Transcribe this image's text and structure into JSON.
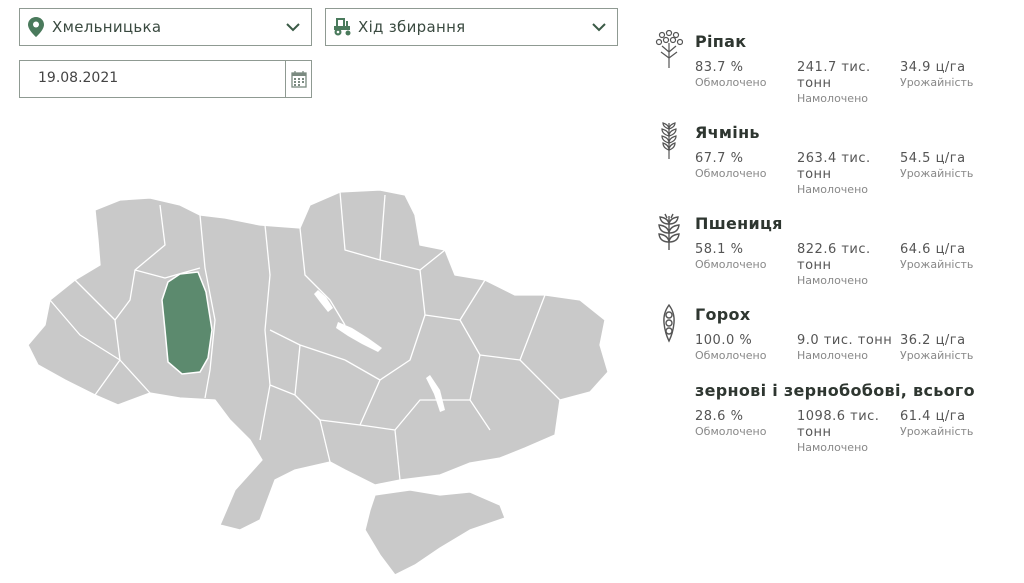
{
  "filters": {
    "region": {
      "value": "Хмельницька"
    },
    "mode": {
      "value": "Хід збирання"
    },
    "date": {
      "value": "19.08.2021"
    }
  },
  "map": {
    "selected_region": "Хмельницька",
    "selected_color": "#5c8a6e",
    "base_color": "#c9c9c9"
  },
  "crops": [
    {
      "name": "Ріпак",
      "icon": "rapeseed-icon",
      "threshed": "83.7 %",
      "threshed_label": "Обмолочено",
      "harvested_l1": "241.7 тис.",
      "harvested_l2": "тонн",
      "harvested_label": "Намолочено",
      "yield": "34.9 ц/га",
      "yield_label": "Урожайність"
    },
    {
      "name": "Ячмінь",
      "icon": "barley-icon",
      "threshed": "67.7 %",
      "threshed_label": "Обмолочено",
      "harvested_l1": "263.4 тис.",
      "harvested_l2": "тонн",
      "harvested_label": "Намолочено",
      "yield": "54.5 ц/га",
      "yield_label": "Урожайність"
    },
    {
      "name": "Пшениця",
      "icon": "wheat-icon",
      "threshed": "58.1 %",
      "threshed_label": "Обмолочено",
      "harvested_l1": "822.6 тис.",
      "harvested_l2": "тонн",
      "harvested_label": "Намолочено",
      "yield": "64.6 ц/га",
      "yield_label": "Урожайність"
    },
    {
      "name": "Горох",
      "icon": "pea-icon",
      "threshed": "100.0 %",
      "threshed_label": "Обмолочено",
      "harvested_l1": "9.0 тис. тонн",
      "harvested_l2": "",
      "harvested_label": "Намолочено",
      "yield": "36.2 ц/га",
      "yield_label": "Урожайність"
    },
    {
      "name": "зернові і зернобобові, всього",
      "icon": "",
      "threshed": "28.6 %",
      "threshed_label": "Обмолочено",
      "harvested_l1": "1098.6 тис.",
      "harvested_l2": "тонн",
      "harvested_label": "Намолочено",
      "yield": "61.4 ц/га",
      "yield_label": "Урожайність"
    }
  ]
}
